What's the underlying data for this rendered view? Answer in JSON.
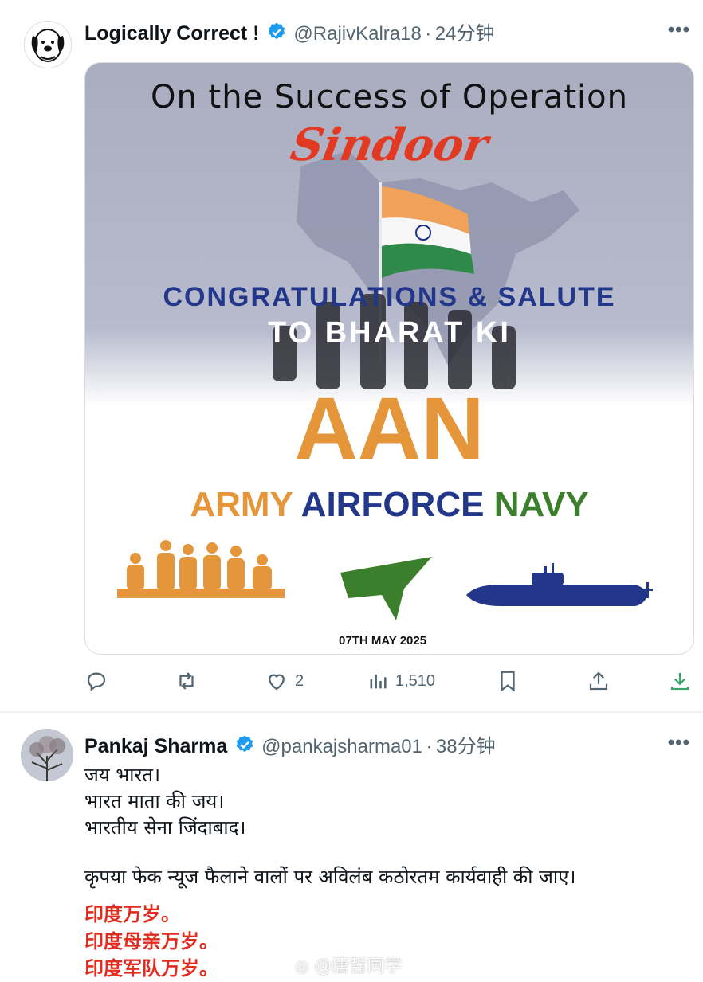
{
  "tweet1": {
    "display_name": "Logically Correct !",
    "handle": "@RajivKalra18",
    "time": "24分钟",
    "more": "•••",
    "poster": {
      "headline": "On the Success of Operation",
      "script_word": "Sindoor",
      "congrats": "CONGRATULATIONS & SALUTE",
      "to_bharat": "TO BHARAT KI",
      "big": "AAN",
      "army": "ARMY",
      "airforce": "AIRFORCE",
      "navy": "NAVY",
      "date": "07TH MAY 2025"
    },
    "stats": {
      "likes": "2",
      "views": "1,510"
    }
  },
  "tweet2": {
    "display_name": "Pankaj Sharma",
    "handle": "@pankajsharma01",
    "time": "38分钟",
    "more": "•••",
    "lines": [
      "जय भारत।",
      "भारत माता की जय।",
      "भारतीय सेना जिंदाबाद।"
    ],
    "paragraph": "कृपया फेक न्यूज फैलाने वालों पर अविलंब कठोरतम कार्यवाही की जाए।",
    "cn_lines": [
      "印度万岁。",
      "印度母亲万岁。",
      "印度军队万岁。"
    ]
  },
  "watermark": "@唐哲同学",
  "colors": {
    "verified": "#1d9bf0",
    "saffron": "#e5963b",
    "navy_blue": "#22378a",
    "green": "#3b7f2c",
    "red_script": "#e23a22"
  }
}
